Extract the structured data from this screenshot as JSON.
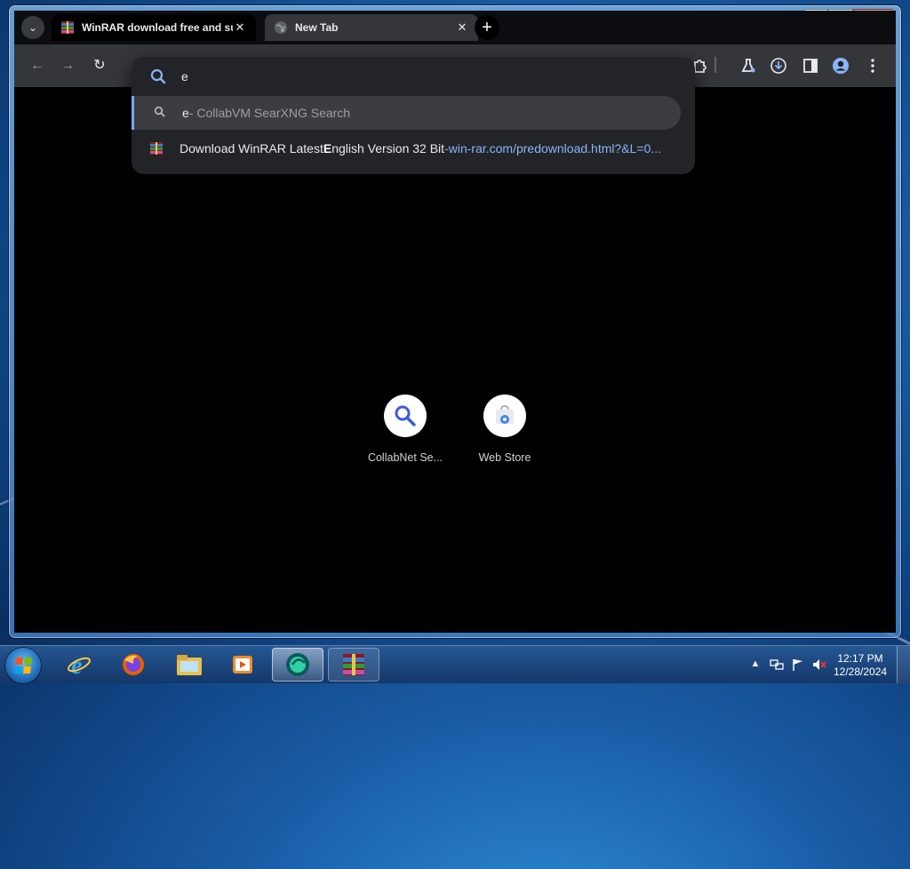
{
  "browser": {
    "tabs": [
      {
        "title": "WinRAR download free and su",
        "active": true
      },
      {
        "title": "New Tab",
        "active": false
      }
    ],
    "close_glyph": "✕",
    "new_tab_glyph": "+",
    "tab_search_glyph": "⌄"
  },
  "toolbar": {
    "back_glyph": "←",
    "forward_glyph": "→",
    "reload_glyph": "↻",
    "icons": [
      "extensions-icon",
      "labs-icon",
      "downloads-icon",
      "side-panel-icon",
      "profile-icon",
      "menu-icon"
    ]
  },
  "omnibox": {
    "value": "e",
    "suggestions": [
      {
        "type": "search",
        "query": "e",
        "provider": " - CollabVM SearXNG Search"
      },
      {
        "type": "history",
        "title_before": "Download WinRAR Latest ",
        "title_bold": "E",
        "title_after": "nglish Version 32 Bit",
        "sep": " - ",
        "url": "win-rar.com/predownload.html?&L=0..."
      }
    ]
  },
  "shortcuts": [
    {
      "label": "CollabNet Se...",
      "icon": "search-icon"
    },
    {
      "label": "Web Store",
      "icon": "web-store-icon"
    }
  ],
  "taskbar": {
    "items": [
      "internet-explorer-icon",
      "firefox-icon",
      "file-explorer-icon",
      "media-player-icon",
      "browser-icon",
      "winrar-icon"
    ],
    "clock": {
      "time": "12:17 PM",
      "date": "12/28/2024"
    }
  },
  "colors": {
    "accent": "#8ab4f8",
    "content_bg": "#000000",
    "toolbar_bg": "#35363a",
    "omnibox_bg": "#232428"
  }
}
